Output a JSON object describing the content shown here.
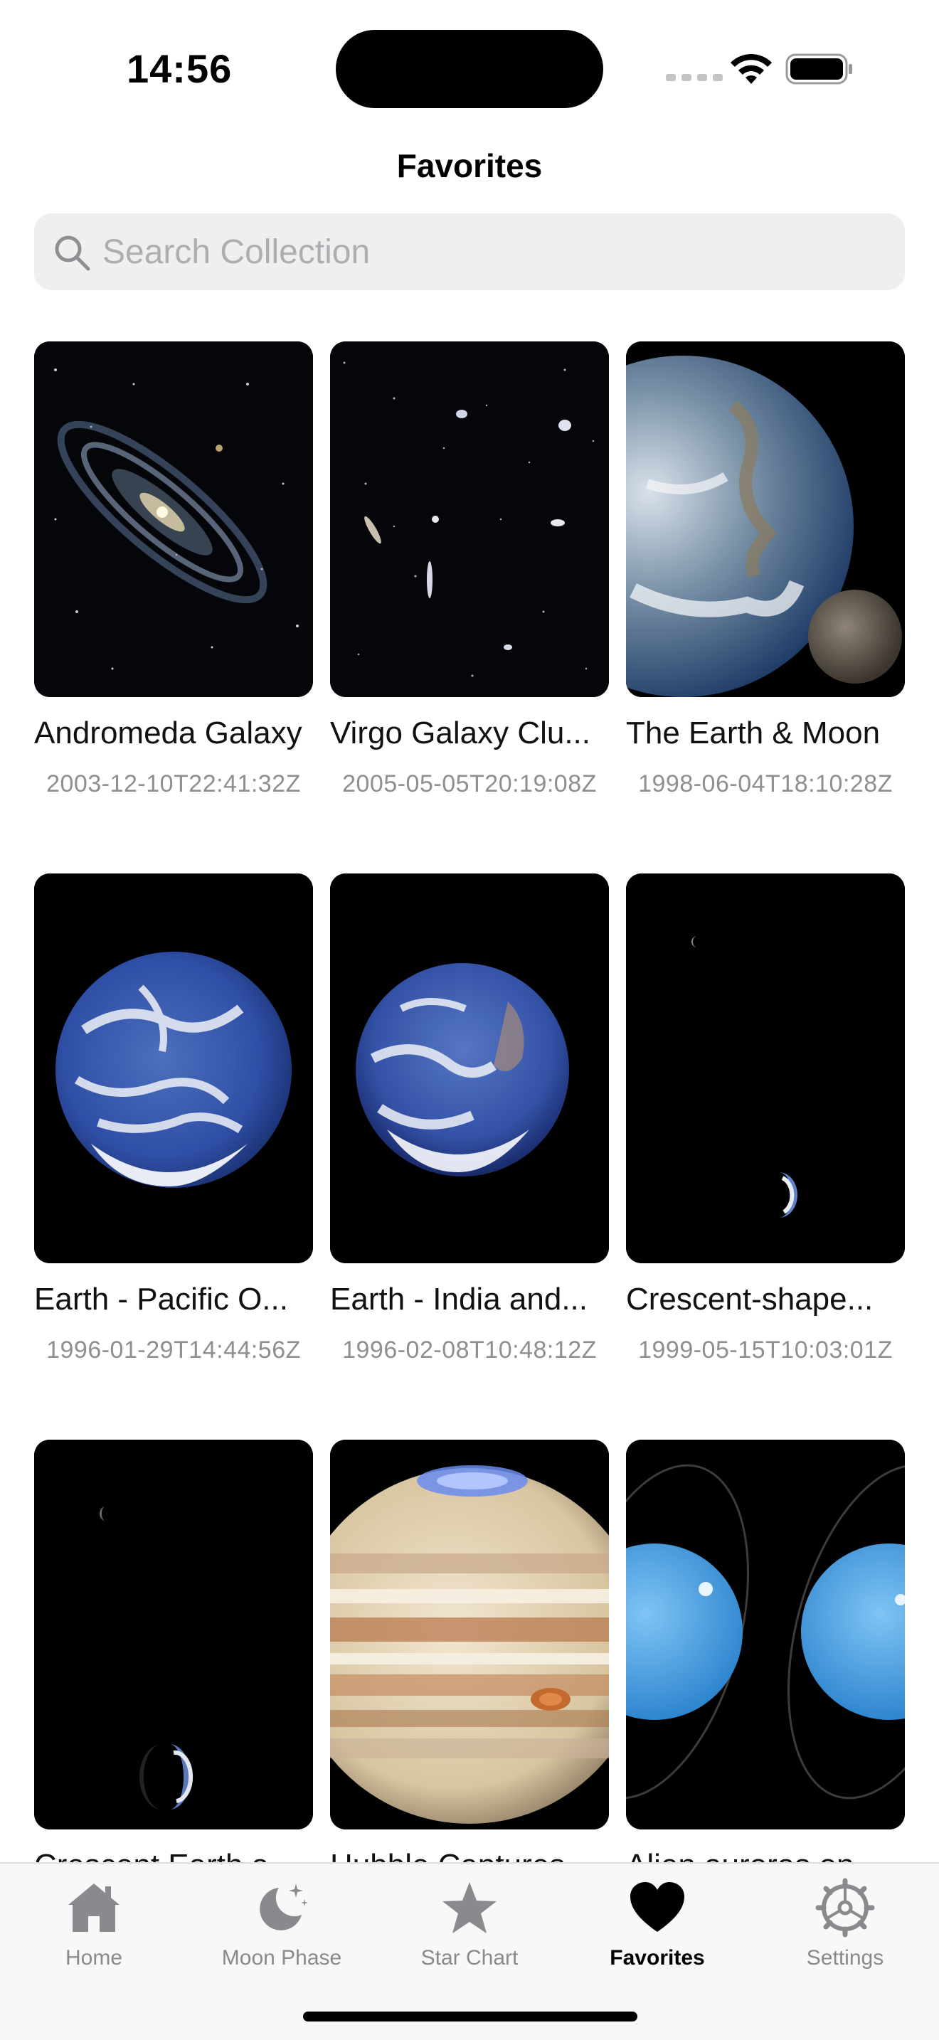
{
  "status_bar": {
    "time": "14:56"
  },
  "nav": {
    "title": "Favorites"
  },
  "search": {
    "placeholder": "Search Collection",
    "value": ""
  },
  "items": [
    {
      "title": "Andromeda Galaxy",
      "date": "2003-12-10T22:41:32Z"
    },
    {
      "title": "Virgo Galaxy Clu...",
      "date": "2005-05-05T20:19:08Z"
    },
    {
      "title": "The Earth & Moon",
      "date": "1998-06-04T18:10:28Z"
    },
    {
      "title": "Earth - Pacific O...",
      "date": "1996-01-29T14:44:56Z"
    },
    {
      "title": "Earth - India and...",
      "date": "1996-02-08T10:48:12Z"
    },
    {
      "title": "Crescent-shape...",
      "date": "1999-05-15T10:03:01Z"
    },
    {
      "title": "Crescent Earth a...",
      "date": ""
    },
    {
      "title": "Hubble Captures...",
      "date": ""
    },
    {
      "title": "Alien auroras on...",
      "date": ""
    }
  ],
  "tabs": [
    {
      "label": "Home",
      "icon": "house-icon",
      "active": false
    },
    {
      "label": "Moon Phase",
      "icon": "moon-stars-icon",
      "active": false
    },
    {
      "label": "Star Chart",
      "icon": "star-icon",
      "active": false
    },
    {
      "label": "Favorites",
      "icon": "heart-icon",
      "active": true
    },
    {
      "label": "Settings",
      "icon": "gear-icon",
      "active": false
    }
  ],
  "colors": {
    "active_tab": "#000000",
    "inactive_tab": "#8a8a8e",
    "search_bg": "#efeff0"
  }
}
